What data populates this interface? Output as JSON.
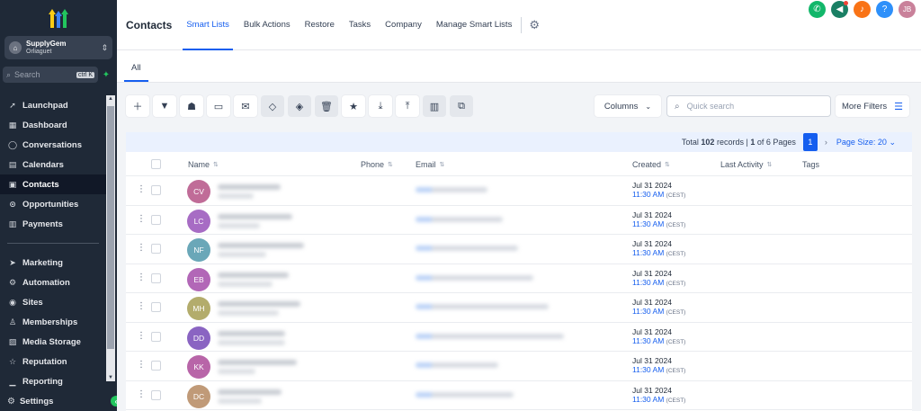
{
  "sidebar": {
    "account_name": "SupplyGem",
    "account_location": "Orliaguet",
    "search_placeholder": "Search",
    "search_shortcut": "ctrl K",
    "items": [
      {
        "label": "Launchpad",
        "icon": "rocket-icon"
      },
      {
        "label": "Dashboard",
        "icon": "grid-icon"
      },
      {
        "label": "Conversations",
        "icon": "chat-icon"
      },
      {
        "label": "Calendars",
        "icon": "calendar-icon"
      },
      {
        "label": "Contacts",
        "icon": "contacts-icon",
        "active": true
      },
      {
        "label": "Opportunities",
        "icon": "opportunities-icon"
      },
      {
        "label": "Payments",
        "icon": "payments-icon"
      }
    ],
    "items2": [
      {
        "label": "Marketing",
        "icon": "send-icon"
      },
      {
        "label": "Automation",
        "icon": "automation-icon"
      },
      {
        "label": "Sites",
        "icon": "globe-icon"
      },
      {
        "label": "Memberships",
        "icon": "membership-icon"
      },
      {
        "label": "Media Storage",
        "icon": "media-icon"
      },
      {
        "label": "Reputation",
        "icon": "star-icon"
      },
      {
        "label": "Reporting",
        "icon": "chart-icon"
      }
    ],
    "settings_label": "Settings"
  },
  "header": {
    "title": "Contacts",
    "tabs": [
      "Smart Lists",
      "Bulk Actions",
      "Restore",
      "Tasks",
      "Company",
      "Manage Smart Lists"
    ],
    "active_tab": "Smart Lists",
    "user_initials": "JB",
    "help": "?"
  },
  "subtabs": [
    "All"
  ],
  "toolbar": {
    "columns_label": "Columns",
    "quick_search_placeholder": "Quick search",
    "more_filters_label": "More Filters"
  },
  "pager": {
    "total_prefix": "Total",
    "total_count": "102",
    "records_word": "records |",
    "page": "1",
    "of_text": "of 6 Pages",
    "current_page": "1",
    "page_size": "Page Size: 20"
  },
  "columns": [
    "Name",
    "Phone",
    "Email",
    "Created",
    "Last Activity",
    "Tags"
  ],
  "rows": [
    {
      "initials": "CV",
      "color": "#c06c98",
      "date": "Jul 31 2024",
      "time": "11:30 AM",
      "tz": "(CEST)"
    },
    {
      "initials": "LC",
      "color": "#a76cc4",
      "date": "Jul 31 2024",
      "time": "11:30 AM",
      "tz": "(CEST)"
    },
    {
      "initials": "NF",
      "color": "#6aa7b8",
      "date": "Jul 31 2024",
      "time": "11:30 AM",
      "tz": "(CEST)"
    },
    {
      "initials": "EB",
      "color": "#b267b7",
      "date": "Jul 31 2024",
      "time": "11:30 AM",
      "tz": "(CEST)"
    },
    {
      "initials": "MH",
      "color": "#b3ac6c",
      "date": "Jul 31 2024",
      "time": "11:30 AM",
      "tz": "(CEST)"
    },
    {
      "initials": "DD",
      "color": "#8a64c2",
      "date": "Jul 31 2024",
      "time": "11:30 AM",
      "tz": "(CEST)"
    },
    {
      "initials": "KK",
      "color": "#b865a8",
      "date": "Jul 31 2024",
      "time": "11:30 AM",
      "tz": "(CEST)"
    },
    {
      "initials": "DC",
      "color": "#c09a78",
      "date": "Jul 31 2024",
      "time": "11:30 AM",
      "tz": "(CEST)"
    }
  ],
  "colors": {
    "accent": "#155eef",
    "sidebar_bg": "#1f2937",
    "phone_btn": "#12b76a",
    "announce_btn": "#1a7f64",
    "bell_btn": "#f97316",
    "help_btn": "#2e90fa",
    "user_btn": "#c9819a"
  }
}
